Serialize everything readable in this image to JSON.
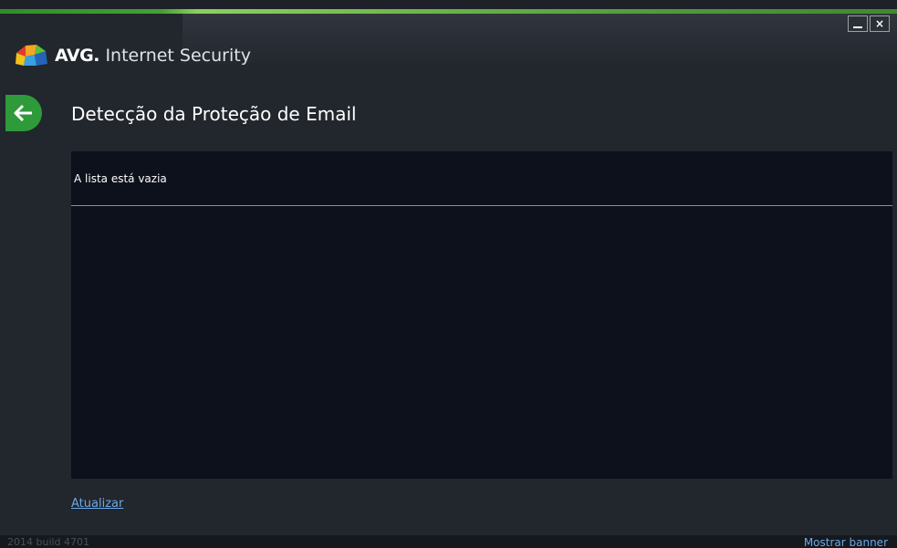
{
  "window": {
    "brand": "AVG",
    "product": "Internet Security",
    "controls": {
      "minimize": "",
      "close": "×"
    }
  },
  "page": {
    "title": "Detecção da Proteção de Email"
  },
  "list": {
    "empty_message": "A lista está vazia"
  },
  "actions": {
    "update_link": "Atualizar"
  },
  "footer": {
    "build": "2014  build 4701",
    "banner_link": "Mostrar banner"
  },
  "colors": {
    "accent_green": "#2e9a3a",
    "link_blue": "#6aa8e8",
    "panel_bg": "#0d111c",
    "window_bg": "#22262d"
  },
  "icons": {
    "back": "back-arrow-icon",
    "logo": "avg-logo-icon"
  }
}
